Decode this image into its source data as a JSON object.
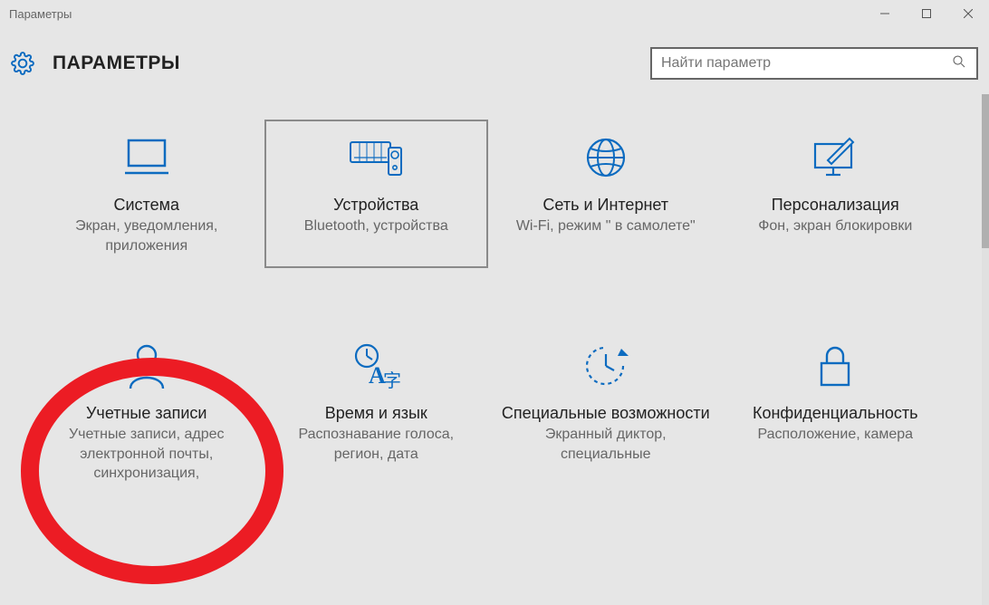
{
  "window": {
    "title": "Параметры"
  },
  "header": {
    "title": "ПАРАМЕТРЫ"
  },
  "search": {
    "placeholder": "Найти параметр"
  },
  "tiles": [
    {
      "title": "Система",
      "sub": "Экран, уведомления, приложения"
    },
    {
      "title": "Устройства",
      "sub": "Bluetooth, устройства"
    },
    {
      "title": "Сеть и Интернет",
      "sub": "Wi-Fi, режим \" в самолете\""
    },
    {
      "title": "Персонализация",
      "sub": "Фон, экран блокировки"
    },
    {
      "title": "Учетные записи",
      "sub": "Учетные записи, адрес электронной почты, синхронизация,"
    },
    {
      "title": "Время и язык",
      "sub": "Распознавание голоса, регион, дата"
    },
    {
      "title": "Специальные возможности",
      "sub": "Экранный диктор, специальные"
    },
    {
      "title": "Конфиденциальность",
      "sub": "Расположение, камера"
    }
  ],
  "selected_index": 1,
  "colors": {
    "accent": "#0c6bc0",
    "highlight_ring": "#ec1c24"
  }
}
